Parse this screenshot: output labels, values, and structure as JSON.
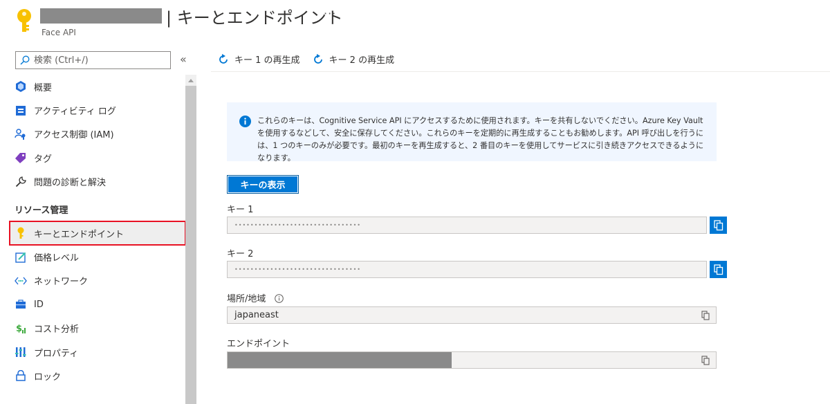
{
  "header": {
    "title": "| キーとエンドポイント",
    "more": "···",
    "subtitle": "Face API"
  },
  "sidebar": {
    "search": {
      "placeholder": "検索 (Ctrl+/)"
    },
    "collapse": "«",
    "items": [
      {
        "label": "概要",
        "icon": "overview-icon"
      },
      {
        "label": "アクティビティ ログ",
        "icon": "activity-log-icon"
      },
      {
        "label": "アクセス制御 (IAM)",
        "icon": "access-control-icon"
      },
      {
        "label": "タグ",
        "icon": "tag-icon"
      },
      {
        "label": "問題の診断と解決",
        "icon": "wrench-icon"
      }
    ],
    "section_title": "リソース管理",
    "resource_items": [
      {
        "label": "キーとエンドポイント",
        "icon": "key-icon",
        "active": true
      },
      {
        "label": "価格レベル",
        "icon": "pricing-tier-icon"
      },
      {
        "label": "ネットワーク",
        "icon": "networking-icon"
      },
      {
        "label": "ID",
        "icon": "identity-icon"
      },
      {
        "label": "コスト分析",
        "icon": "cost-analysis-icon"
      },
      {
        "label": "プロパティ",
        "icon": "properties-icon"
      },
      {
        "label": "ロック",
        "icon": "lock-icon"
      }
    ]
  },
  "toolbar": {
    "regen_key1": "キー 1 の再生成",
    "regen_key2": "キー 2 の再生成"
  },
  "info": {
    "text": "これらのキーは、Cognitive Service API にアクセスするために使用されます。キーを共有しないでください。Azure Key Vault を使用するなどして、安全に保存してください。これらのキーを定期的に再生成することもお勧めします。API 呼び出しを行うには、1 つのキーのみが必要です。最初のキーを再生成すると、2 番目のキーを使用してサービスに引き続きアクセスできるようになります。"
  },
  "show_keys_label": "キーの表示",
  "key1": {
    "label": "キー 1",
    "value": "••••••••••••••••••••••••••••••••"
  },
  "key2": {
    "label": "キー 2",
    "value": "••••••••••••••••••••••••••••••••"
  },
  "location": {
    "label": "場所/地域",
    "value": "japaneast"
  },
  "endpoint": {
    "label": "エンドポイント"
  },
  "colors": {
    "accent": "#0078d4",
    "active_outline": "#e81123",
    "info_bg": "#f0f6ff"
  }
}
